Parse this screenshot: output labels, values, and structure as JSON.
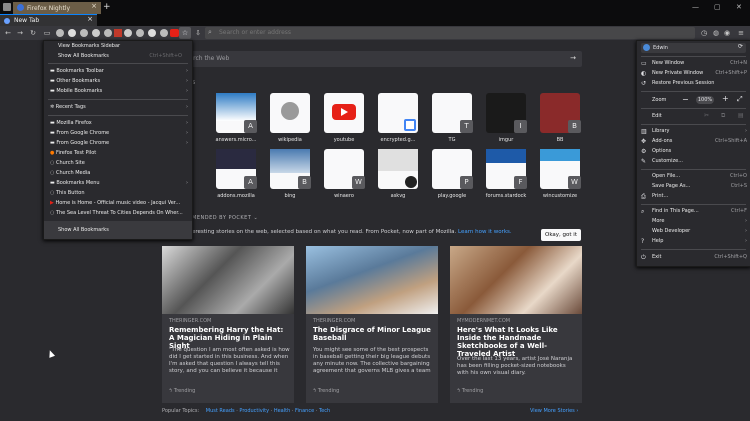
{
  "window": {
    "title": "Firefox Nightly"
  },
  "tabs": {
    "new_tab": "New Tab"
  },
  "url": {
    "placeholder": "Search or enter address"
  },
  "content": {
    "search_placeholder": "Search the Web",
    "top_sites_label": "S",
    "top_sites": [
      {
        "label": "answers.micro..."
      },
      {
        "label": "wikipedia"
      },
      {
        "label": "youtube"
      },
      {
        "label": "encrypted.g..."
      },
      {
        "label": "TG"
      },
      {
        "label": "imgur"
      },
      {
        "label": "BB"
      },
      {
        "label": "addons.mozilla"
      },
      {
        "label": "bing"
      },
      {
        "label": "winaero"
      },
      {
        "label": "askvg"
      },
      {
        "label": "play.google"
      },
      {
        "label": "forums.stardock"
      },
      {
        "label": "wincustomize"
      }
    ],
    "tile_letters": [
      "A",
      "T",
      "I",
      "B",
      "A",
      "B",
      "W",
      "P",
      "F",
      "W"
    ],
    "pocket_label": "MENDED BY POCKET",
    "pocket_desc": "eresting stories on the web, selected based on what you read. From Pocket, now part of Mozilla.",
    "pocket_link": "Learn how it works.",
    "okay_button": "Okay, got it",
    "cards": [
      {
        "source": "THERINGER.COM",
        "title": "Remembering Harry the Hat: A Magician Hiding in Plain Sight",
        "body": "\"The question I am most often asked is how did I get started in this business. And when I'm asked that question I always tell this story, and you can believe it because it",
        "trend": "Trending"
      },
      {
        "source": "THERINGER.COM",
        "title": "The Disgrace of Minor League Baseball",
        "body": "You might see some of the best prospects in baseball getting their big league debuts any minute now. The collective bargaining agreement that governs MLB gives a team",
        "trend": "Trending"
      },
      {
        "source": "MYMODERNMET.COM",
        "title": "Here's What It Looks Like Inside the Handmade Sketchbooks of a Well-Traveled Artist",
        "body": "Over the last 13 years, artist José Naranja has been filling pocket-sized notebooks with his own visual diary.",
        "trend": "Trending"
      }
    ],
    "popular_label": "Popular Topics:",
    "topics": [
      "Must Reads",
      "Productivity",
      "Health",
      "Finance",
      "Tech"
    ],
    "view_more": "View More Stories"
  },
  "bookmarks_menu": {
    "items": [
      "View Bookmarks Sidebar",
      "Show All Bookmarks",
      "Bookmarks Toolbar",
      "Other Bookmarks",
      "Mobile Bookmarks",
      "Recent Tags",
      "Mozilla Firefox",
      "From Google Chrome",
      "From Google Chrome",
      "Firefox Test Pilot",
      "Church Site",
      "Church Media",
      "Bookmarks Menu",
      "This Button",
      "Home is Home - Official music video - Jacqui Ver...",
      "The Sea Level Threat To Cities Depends On Wher...",
      "Show All Bookmarks"
    ],
    "shortcut": "Ctrl+Shift+O"
  },
  "app_menu": {
    "user": "Edwin",
    "items": {
      "new_window": "New Window",
      "new_window_sc": "Ctrl+N",
      "new_private": "New Private Window",
      "new_private_sc": "Ctrl+Shift+P",
      "restore": "Restore Previous Session",
      "zoom": "Zoom",
      "zoom_level": "100%",
      "edit": "Edit",
      "library": "Library",
      "addons": "Add-ons",
      "addons_sc": "Ctrl+Shift+A",
      "options": "Options",
      "customize": "Customize...",
      "open_file": "Open File...",
      "open_file_sc": "Ctrl+O",
      "save_page": "Save Page As...",
      "save_page_sc": "Ctrl+S",
      "print": "Print...",
      "find": "Find in This Page...",
      "find_sc": "Ctrl+F",
      "more": "More",
      "web_dev": "Web Developer",
      "help": "Help",
      "exit": "Exit",
      "exit_sc": "Ctrl+Shift+Q"
    }
  }
}
